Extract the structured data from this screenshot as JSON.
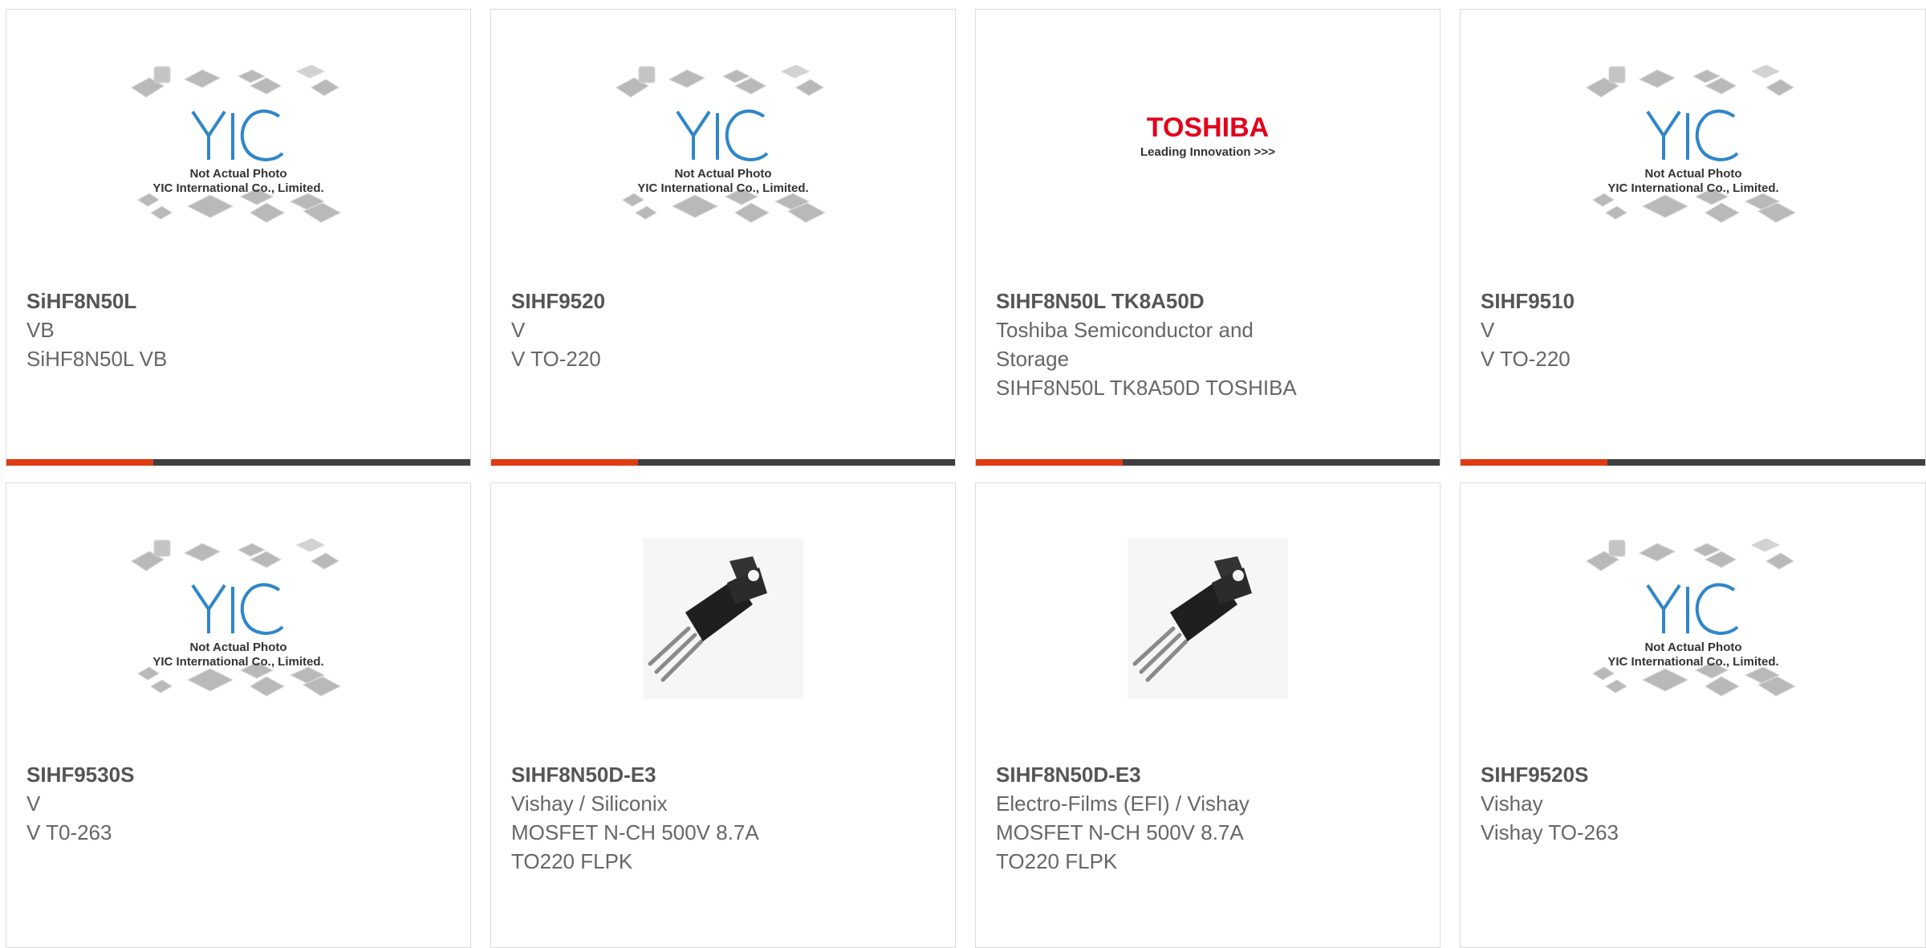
{
  "colors": {
    "accent": "#e03c13",
    "bar": "#3f3f3f",
    "border": "#dcdcdc",
    "text": "#666666",
    "yic_blue": "#2f86c8",
    "toshiba_red": "#e3001b"
  },
  "products": [
    {
      "name": "SiHF8N50L",
      "manufacturer": "VB",
      "description": "SiHF8N50L VB",
      "image": "yic-placeholder-image",
      "placeholder_line1": "Not Actual Photo",
      "placeholder_line2": "YIC International Co., Limited."
    },
    {
      "name": "SIHF9520",
      "manufacturer": "V",
      "description": "V TO-220",
      "image": "yic-placeholder-image",
      "placeholder_line1": "Not Actual Photo",
      "placeholder_line2": "YIC International Co., Limited."
    },
    {
      "name": "SIHF8N50L TK8A50D",
      "manufacturer": "Toshiba Semiconductor and Storage",
      "description": "SIHF8N50L TK8A50D TOSHIBA",
      "image": "toshiba-logo-image",
      "logo_text": "TOSHIBA",
      "logo_tagline": "Leading Innovation >>>"
    },
    {
      "name": "SIHF9510",
      "manufacturer": "V",
      "description": "V TO-220",
      "image": "yic-placeholder-image",
      "placeholder_line1": "Not Actual Photo",
      "placeholder_line2": "YIC International Co., Limited."
    },
    {
      "name": "SIHF9530S",
      "manufacturer": "V",
      "description": "V T0-263",
      "image": "yic-placeholder-image",
      "placeholder_line1": "Not Actual Photo",
      "placeholder_line2": "YIC International Co., Limited."
    },
    {
      "name": "SIHF8N50D-E3",
      "manufacturer": "Vishay / Siliconix",
      "description": "MOSFET N-CH 500V 8.7A TO220 FLPK",
      "image": "to220-transistor-image"
    },
    {
      "name": "SIHF8N50D-E3",
      "manufacturer": "Electro-Films (EFI) / Vishay",
      "description": "MOSFET N-CH 500V 8.7A TO220 FLPK",
      "image": "to220-transistor-image"
    },
    {
      "name": "SIHF9520S",
      "manufacturer": "Vishay",
      "description": "Vishay TO-263",
      "image": "yic-placeholder-image",
      "placeholder_line1": "Not Actual Photo",
      "placeholder_line2": "YIC International Co., Limited."
    }
  ]
}
